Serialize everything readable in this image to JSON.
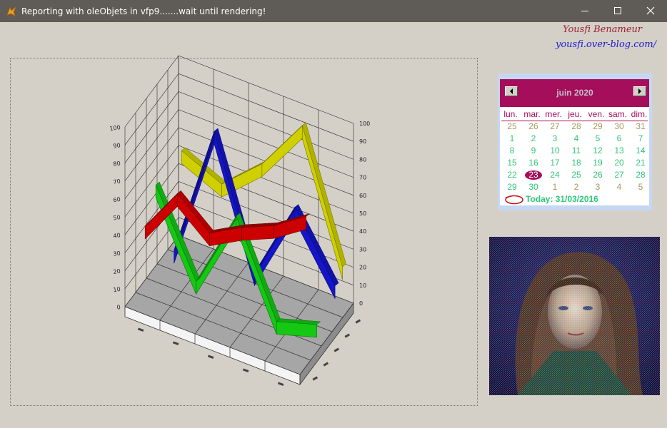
{
  "window": {
    "title": "Reporting with oleObjets in vfp9.......wait until rendering!",
    "controls": [
      "minimize",
      "maximize",
      "close"
    ]
  },
  "author": {
    "name": "Yousfi Benameur",
    "blog": "yousfi.over-blog.com/"
  },
  "calendar": {
    "month_label": "juin 2020",
    "weekdays": [
      "lun.",
      "mar.",
      "mer.",
      "jeu.",
      "ven.",
      "sam.",
      "dim."
    ],
    "weeks": [
      [
        {
          "d": "25",
          "m": "prev"
        },
        {
          "d": "26",
          "m": "prev"
        },
        {
          "d": "27",
          "m": "prev"
        },
        {
          "d": "28",
          "m": "prev"
        },
        {
          "d": "29",
          "m": "prev"
        },
        {
          "d": "30",
          "m": "prev"
        },
        {
          "d": "31",
          "m": "prev"
        }
      ],
      [
        {
          "d": "1",
          "m": "cur"
        },
        {
          "d": "2",
          "m": "cur"
        },
        {
          "d": "3",
          "m": "cur"
        },
        {
          "d": "4",
          "m": "cur"
        },
        {
          "d": "5",
          "m": "cur"
        },
        {
          "d": "6",
          "m": "cur"
        },
        {
          "d": "7",
          "m": "cur"
        }
      ],
      [
        {
          "d": "8",
          "m": "cur"
        },
        {
          "d": "9",
          "m": "cur"
        },
        {
          "d": "10",
          "m": "cur"
        },
        {
          "d": "11",
          "m": "cur"
        },
        {
          "d": "12",
          "m": "cur"
        },
        {
          "d": "13",
          "m": "cur"
        },
        {
          "d": "14",
          "m": "cur"
        }
      ],
      [
        {
          "d": "15",
          "m": "cur"
        },
        {
          "d": "16",
          "m": "cur"
        },
        {
          "d": "17",
          "m": "cur"
        },
        {
          "d": "18",
          "m": "cur"
        },
        {
          "d": "19",
          "m": "cur"
        },
        {
          "d": "20",
          "m": "cur"
        },
        {
          "d": "21",
          "m": "cur"
        }
      ],
      [
        {
          "d": "22",
          "m": "cur"
        },
        {
          "d": "23",
          "m": "sel"
        },
        {
          "d": "24",
          "m": "cur"
        },
        {
          "d": "25",
          "m": "cur"
        },
        {
          "d": "26",
          "m": "cur"
        },
        {
          "d": "27",
          "m": "cur"
        },
        {
          "d": "28",
          "m": "cur"
        }
      ],
      [
        {
          "d": "29",
          "m": "cur"
        },
        {
          "d": "30",
          "m": "cur"
        },
        {
          "d": "1",
          "m": "next"
        },
        {
          "d": "2",
          "m": "next"
        },
        {
          "d": "3",
          "m": "next"
        },
        {
          "d": "4",
          "m": "next"
        },
        {
          "d": "5",
          "m": "next"
        }
      ]
    ],
    "today_label": "Today: 31/03/2016",
    "colors": {
      "header": "#a50e5b",
      "current_month": "#2fc77a",
      "other_month": "#a79a5c"
    }
  },
  "chart_data": {
    "type": "line",
    "subtype": "3d-ribbon",
    "y_axis_left": {
      "ticks": [
        "0",
        "10",
        "20",
        "30",
        "40",
        "50",
        "60",
        "70",
        "80",
        "90",
        "100"
      ],
      "ylim": [
        0,
        100
      ]
    },
    "y_axis_right": {
      "ticks": [
        "0",
        "10",
        "20",
        "30",
        "40",
        "50",
        "60",
        "70",
        "80",
        "90",
        "100"
      ]
    },
    "series": [
      {
        "color": "#cc0000",
        "values": [
          40,
          65,
          50,
          60,
          68,
          80
        ]
      },
      {
        "color": "#1414c8",
        "values": [
          5,
          80,
          10,
          55,
          20
        ]
      },
      {
        "color": "#14c814",
        "values": [
          55,
          10,
          55,
          5,
          12
        ]
      },
      {
        "color": "#d0d000",
        "values": [
          55,
          45,
          65,
          95,
          25
        ]
      }
    ],
    "floor_color": "#a6a6a6",
    "grid": true
  },
  "photo": {
    "icon": "portrait-photo"
  }
}
